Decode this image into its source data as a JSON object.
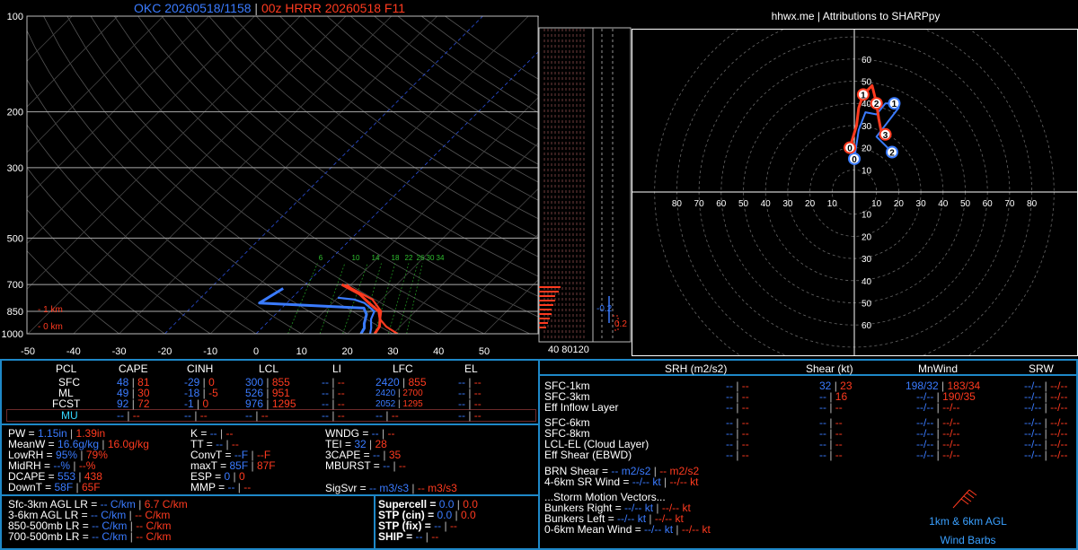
{
  "header": {
    "obs_title": "OKC 20260518/1158",
    "sep": " | ",
    "model_title": "00z HRRR 20260518 F11"
  },
  "hodo_header": "hhwx.me | Attributions to SHARPpy",
  "colors": {
    "blue": "#3a7bff",
    "red": "#ff3a1f",
    "cyan": "#35d8ff",
    "border": "#1e88c8"
  },
  "chart_data": [
    {
      "type": "line",
      "name": "skew-t",
      "x_ticks": [
        "-50",
        "-40",
        "-30",
        "-20",
        "-10",
        "0",
        "10",
        "20",
        "30",
        "40",
        "50"
      ],
      "xlim": [
        -50,
        50
      ],
      "y_pressure_labels": [
        "100",
        "200",
        "300",
        "500",
        "700",
        "850",
        "1000"
      ],
      "ylim": [
        1000,
        100
      ],
      "height_labels": [
        "1 km",
        "0 km"
      ],
      "mixing_ratio_labels": [
        "6",
        "10",
        "14",
        "18",
        "22",
        "26",
        "30",
        "34"
      ],
      "series": [
        {
          "color": "#ff3a1f",
          "points": [
            [
              26,
              1000
            ],
            [
              25.5,
              950
            ],
            [
              24,
              900
            ],
            [
              22,
              850
            ],
            [
              18,
              800
            ],
            [
              14,
              750
            ],
            [
              8,
              700
            ]
          ]
        },
        {
          "color": "#3a7bff",
          "points": [
            [
              23,
              1000
            ],
            [
              22.5,
              960
            ],
            [
              21.5,
              930
            ],
            [
              20,
              870
            ],
            [
              18,
              830
            ],
            [
              -6,
              800
            ],
            [
              -4,
              720
            ]
          ]
        },
        {
          "color": "#ff3a1f",
          "points": [
            [
              31,
              1000
            ],
            [
              27,
              950
            ],
            [
              24,
              900
            ],
            [
              22.5,
              850
            ],
            [
              18,
              780
            ],
            [
              11,
              720
            ],
            [
              9,
              700
            ]
          ]
        },
        {
          "color": "#3a7bff",
          "points": [
            [
              25,
              1000
            ],
            [
              24,
              960
            ],
            [
              22,
              900
            ],
            [
              21,
              850
            ],
            [
              17,
              800
            ],
            [
              14,
              780
            ],
            [
              10,
              770
            ]
          ]
        }
      ]
    },
    {
      "type": "line",
      "name": "hodograph",
      "x_ticks": [
        "80",
        "70",
        "60",
        "50",
        "40",
        "30",
        "20",
        "10",
        "10",
        "20",
        "30",
        "40",
        "50",
        "60",
        "70",
        "80"
      ],
      "y_ticks_up": [
        "60",
        "50",
        "40",
        "30",
        "20",
        "10"
      ],
      "y_ticks_down": [
        "10",
        "20",
        "30",
        "40",
        "50",
        "60"
      ],
      "series": [
        {
          "color": "#3a7bff",
          "labels": [
            "0",
            "1",
            "2"
          ],
          "points": [
            [
              0,
              15
            ],
            [
              2,
              28
            ],
            [
              5,
              36
            ],
            [
              10,
              35
            ],
            [
              14,
              40
            ],
            [
              18,
              40
            ],
            [
              20,
              38
            ],
            [
              10,
              25
            ],
            [
              17,
              18
            ]
          ]
        },
        {
          "color": "#ff3a1f",
          "labels": [
            "0",
            "1",
            "2",
            "3"
          ],
          "points": [
            [
              -2,
              20
            ],
            [
              1,
              30
            ],
            [
              2,
              38
            ],
            [
              4,
              44
            ],
            [
              8,
              48
            ],
            [
              10,
              40
            ],
            [
              11,
              33
            ],
            [
              12,
              28
            ],
            [
              14,
              26
            ]
          ]
        }
      ]
    }
  ],
  "side_labels": {
    "ebwd_blue": "-0.2",
    "ebwd_red": "0.2",
    "wind_axis": "40 80120"
  },
  "parcel_table": {
    "headers": [
      "PCL",
      "CAPE",
      "CINH",
      "LCL",
      "LI",
      "LFC",
      "EL"
    ],
    "rows": [
      {
        "name": "SFC",
        "cape": [
          "48",
          "81"
        ],
        "cinh": [
          "-29",
          "0"
        ],
        "lcl": [
          "300",
          "855"
        ],
        "li": [
          "--",
          "--"
        ],
        "lfc": [
          "2420",
          "855"
        ],
        "el": [
          "--",
          "--"
        ]
      },
      {
        "name": "ML",
        "cape": [
          "49",
          "30"
        ],
        "cinh": [
          "-18",
          "-5"
        ],
        "lcl": [
          "526",
          "951"
        ],
        "li": [
          "--",
          "--"
        ],
        "lfc": [
          "2420",
          "2700"
        ],
        "el": [
          "--",
          "--"
        ]
      },
      {
        "name": "FCST",
        "cape": [
          "92",
          "72"
        ],
        "cinh": [
          "-1",
          "0"
        ],
        "lcl": [
          "976",
          "1295"
        ],
        "li": [
          "--",
          "--"
        ],
        "lfc": [
          "2052",
          "1295"
        ],
        "el": [
          "--",
          "--"
        ]
      },
      {
        "name": "MU",
        "cape": [
          "--",
          "--"
        ],
        "cinh": [
          "--",
          "--"
        ],
        "lcl": [
          "--",
          "--"
        ],
        "li": [
          "--",
          "--"
        ],
        "lfc": [
          "--",
          "--"
        ],
        "el": [
          "--",
          "--"
        ]
      }
    ]
  },
  "thermo": {
    "col1": [
      {
        "label": "PW = ",
        "a": "1.15in",
        "b": "1.39in"
      },
      {
        "label": "MeanW = ",
        "a": "16.6g/kg",
        "b": "16.0g/kg"
      },
      {
        "label": "LowRH = ",
        "a": "95%",
        "b": "79%"
      },
      {
        "label": "MidRH = ",
        "a": "--%",
        "b": "--%"
      },
      {
        "label": "DCAPE = ",
        "a": "553",
        "b": "438"
      },
      {
        "label": "DownT = ",
        "a": "58F",
        "b": "65F"
      }
    ],
    "col2": [
      {
        "label": "K = ",
        "a": "--",
        "b": "--"
      },
      {
        "label": "TT = ",
        "a": "--",
        "b": "--"
      },
      {
        "label": "ConvT = ",
        "a": "--F",
        "b": "--F"
      },
      {
        "label": "maxT = ",
        "a": "85F",
        "b": "87F"
      },
      {
        "label": "ESP = ",
        "a": "0",
        "b": "0"
      },
      {
        "label": "MMP = ",
        "a": "--",
        "b": "--"
      }
    ],
    "col3": [
      {
        "label": "WNDG = ",
        "a": "--",
        "b": "--"
      },
      {
        "label": "TEI = ",
        "a": "32",
        "b": "28"
      },
      {
        "label": "3CAPE = ",
        "a": "--",
        "b": "35"
      },
      {
        "label": "MBURST = ",
        "a": "--",
        "b": "--"
      }
    ],
    "sigsvr": {
      "label": "SigSvr = ",
      "a": "-- m3/s3",
      "b": "-- m3/s3"
    }
  },
  "lapse": [
    {
      "label": "Sfc-3km AGL LR = ",
      "a": "-- C/km",
      "b": "6.7 C/km"
    },
    {
      "label": "3-6km AGL LR = ",
      "a": "-- C/km",
      "b": "-- C/km"
    },
    {
      "label": "850-500mb LR = ",
      "a": "-- C/km",
      "b": "-- C/km"
    },
    {
      "label": "700-500mb LR = ",
      "a": "-- C/km",
      "b": "-- C/km"
    }
  ],
  "composite": [
    {
      "label": "Supercell = ",
      "a": "0.0",
      "b": "0.0"
    },
    {
      "label": "STP (cin) = ",
      "a": "0.0",
      "b": "0.0"
    },
    {
      "label": "STP (fix) = ",
      "a": "--",
      "b": "--"
    },
    {
      "label": "SHIP = ",
      "a": "--",
      "b": "--"
    }
  ],
  "kinematic": {
    "headers": [
      "SRH (m2/s2)",
      "Shear (kt)",
      "MnWind",
      "SRW"
    ],
    "rows": [
      {
        "name": "SFC-1km",
        "srh": [
          "--",
          "--"
        ],
        "shear": [
          "32",
          "23"
        ],
        "mnwind": [
          "198/32",
          "183/34"
        ],
        "srw": [
          "--/--",
          "--/--"
        ]
      },
      {
        "name": "SFC-3km",
        "srh": [
          "--",
          "--"
        ],
        "shear": [
          "--",
          "16"
        ],
        "mnwind": [
          "--/--",
          "190/35"
        ],
        "srw": [
          "--/--",
          "--/--"
        ]
      },
      {
        "name": "Eff Inflow Layer",
        "srh": [
          "--",
          "--"
        ],
        "shear": [
          "--",
          "--"
        ],
        "mnwind": [
          "--/--",
          "--/--"
        ],
        "srw": [
          "--/--",
          "--/--"
        ]
      },
      {
        "name": "SFC-6km",
        "srh": [
          "--",
          "--"
        ],
        "shear": [
          "--",
          "--"
        ],
        "mnwind": [
          "--/--",
          "--/--"
        ],
        "srw": [
          "--/--",
          "--/--"
        ]
      },
      {
        "name": "SFC-8km",
        "srh": [
          "--",
          "--"
        ],
        "shear": [
          "--",
          "--"
        ],
        "mnwind": [
          "--/--",
          "--/--"
        ],
        "srw": [
          "--/--",
          "--/--"
        ]
      },
      {
        "name": "LCL-EL (Cloud Layer)",
        "srh": [
          "--",
          "--"
        ],
        "shear": [
          "--",
          "--"
        ],
        "mnwind": [
          "--/--",
          "--/--"
        ],
        "srw": [
          "--/--",
          "--/--"
        ]
      },
      {
        "name": "Eff Shear (EBWD)",
        "srh": [
          "--",
          "--"
        ],
        "shear": [
          "--",
          "--"
        ],
        "mnwind": [
          "--/--",
          "--/--"
        ],
        "srw": [
          "--/--",
          "--/--"
        ]
      }
    ],
    "brn": {
      "label": "BRN Shear = ",
      "a": "-- m2/s2",
      "b": "-- m2/s2"
    },
    "sr46": {
      "label": "4-6km SR Wind = ",
      "a": "--/-- kt",
      "b": "--/-- kt"
    },
    "storm_title": "...Storm Motion Vectors...",
    "storm": [
      {
        "label": "Bunkers Right = ",
        "a": "--/-- kt",
        "b": "--/-- kt"
      },
      {
        "label": "Bunkers Left = ",
        "a": "--/-- kt",
        "b": "--/-- kt"
      },
      {
        "label": "0-6km Mean Wind = ",
        "a": "--/-- kt",
        "b": "--/-- kt"
      }
    ],
    "barb_label1": "1km & 6km AGL",
    "barb_label2": "Wind Barbs"
  }
}
